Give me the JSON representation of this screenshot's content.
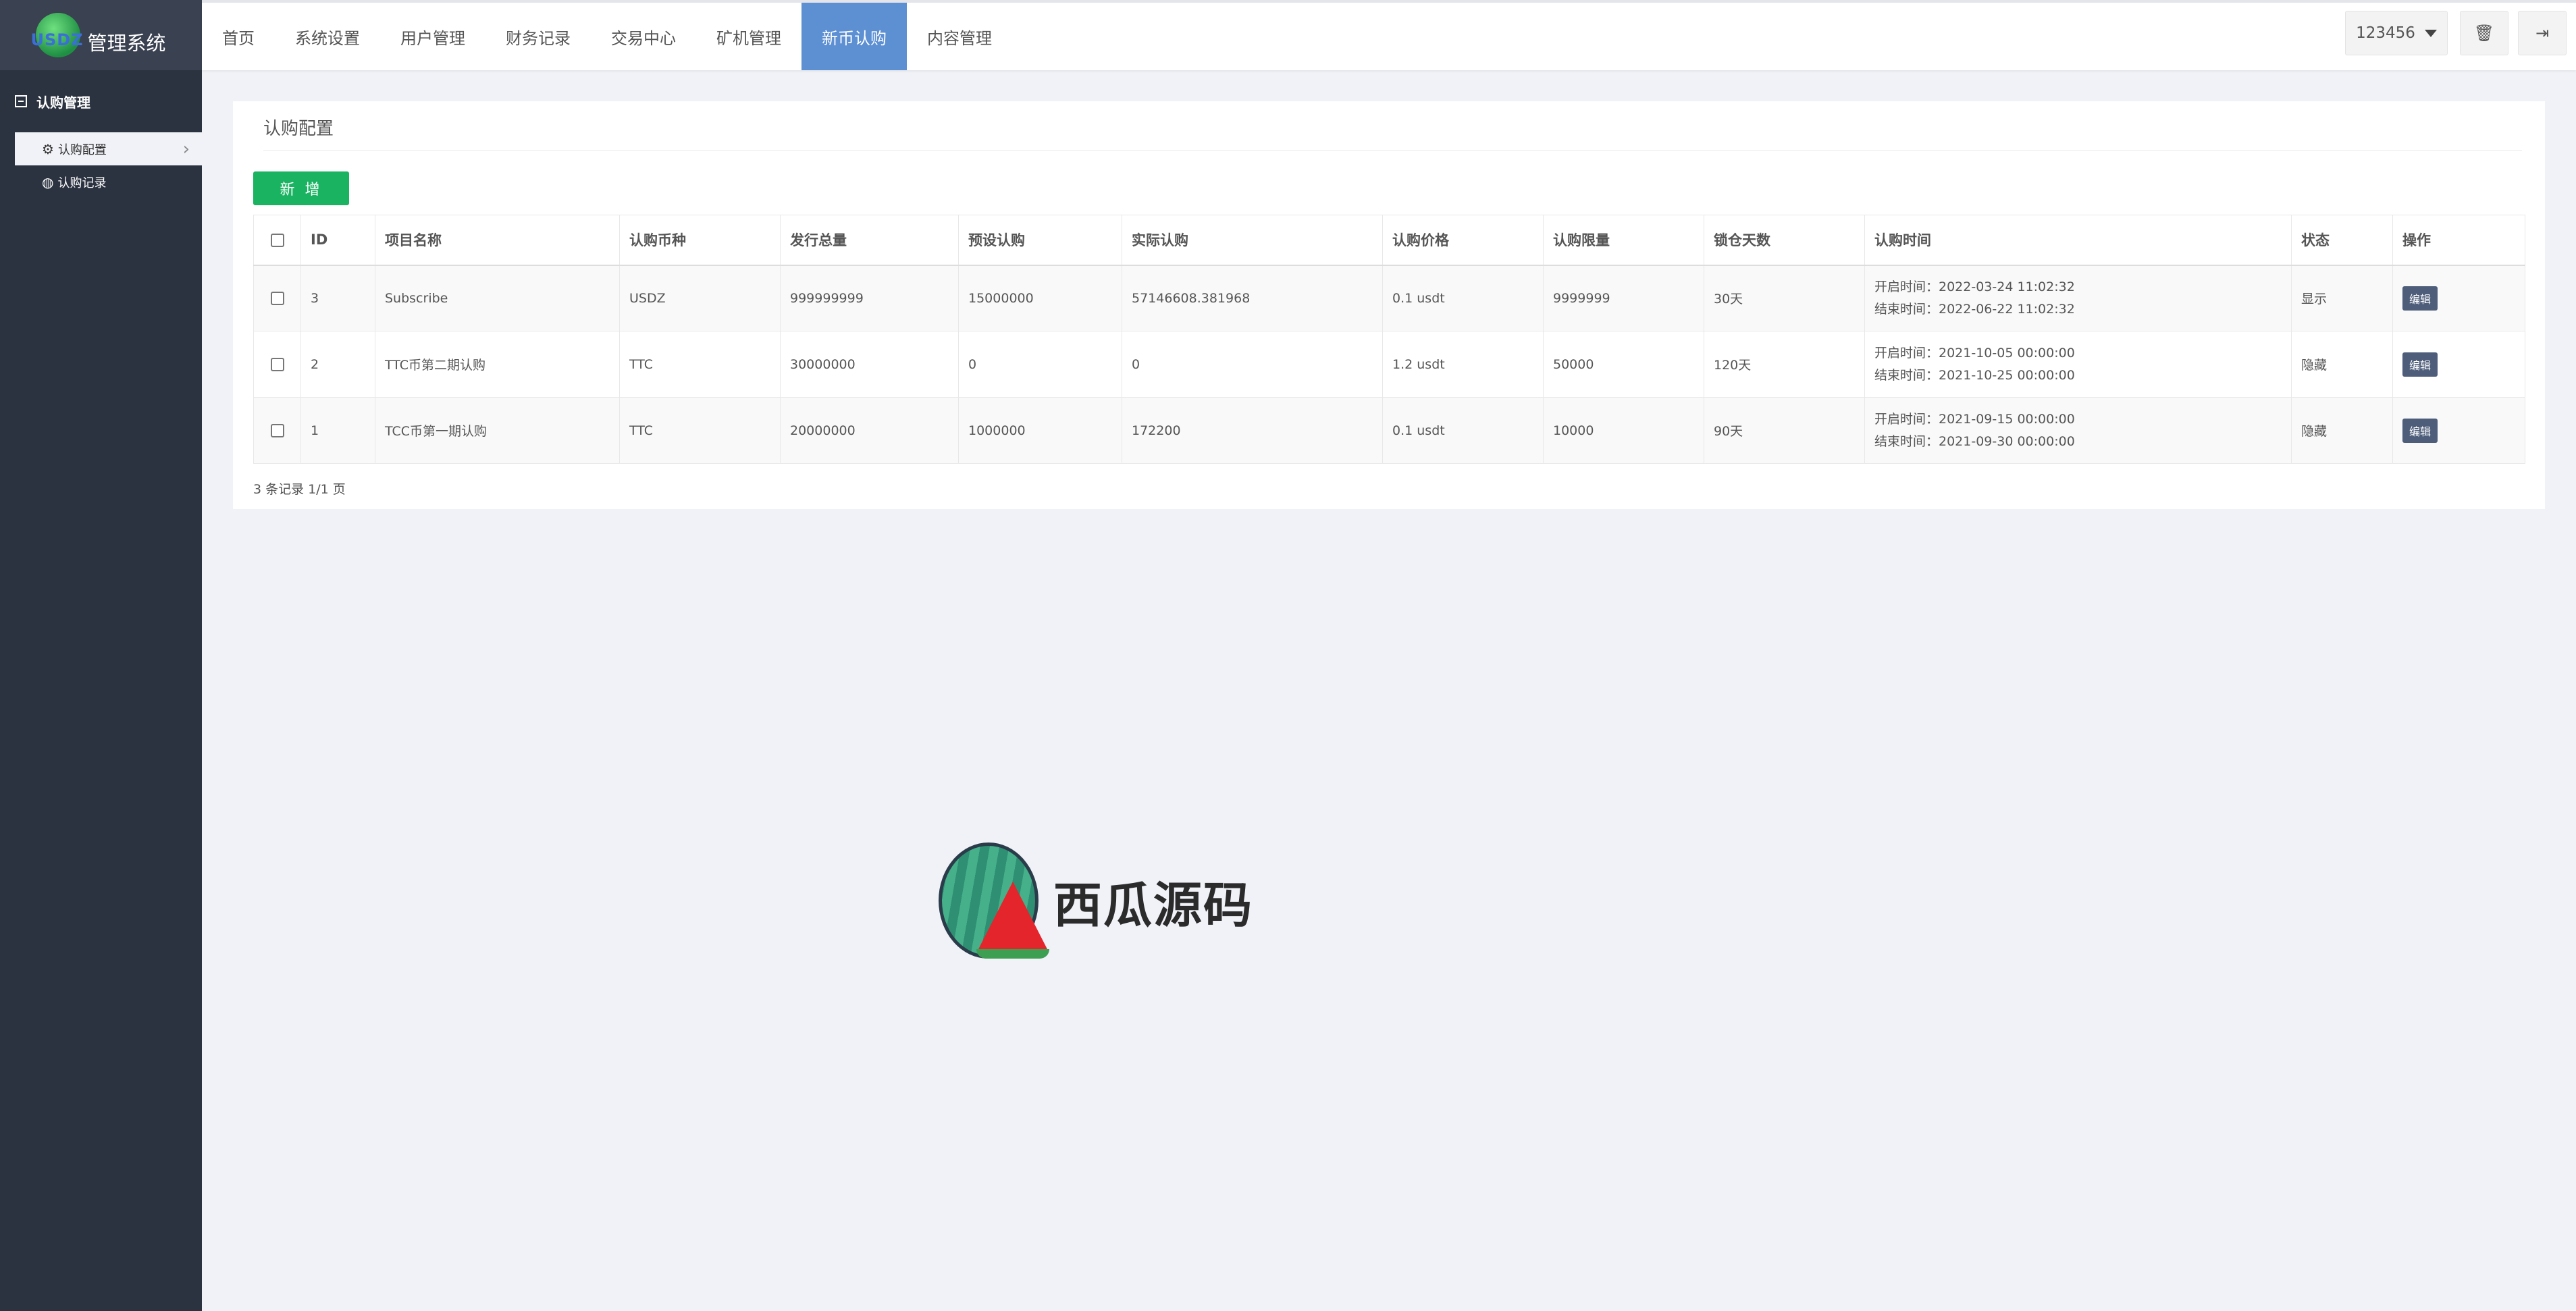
{
  "logo": {
    "mark": "USDZ",
    "text": "管理系统"
  },
  "sidebar": {
    "group_label": "认购管理",
    "items": [
      {
        "label": "认购配置",
        "icon": "gear-icon"
      },
      {
        "label": "认购记录",
        "icon": "globe-icon"
      }
    ]
  },
  "nav": {
    "items": [
      "首页",
      "系统设置",
      "用户管理",
      "财务记录",
      "交易中心",
      "矿机管理",
      "新币认购",
      "内容管理"
    ],
    "active_index": 6
  },
  "header": {
    "user": "123456",
    "clear_cache_icon": "trash-icon",
    "logout_icon": "logout-icon"
  },
  "panel": {
    "title": "认购配置",
    "add_label": "新 增",
    "footer": "3 条记录 1/1 页"
  },
  "table": {
    "columns": [
      "ID",
      "项目名称",
      "认购币种",
      "发行总量",
      "预设认购",
      "实际认购",
      "认购价格",
      "认购限量",
      "锁仓天数",
      "认购时间",
      "状态",
      "操作"
    ],
    "rows": [
      {
        "id": "3",
        "name": "Subscribe",
        "coin": "USDZ",
        "total": "999999999",
        "preset": "15000000",
        "actual": "57146608.381968",
        "price": "0.1 usdt",
        "limit": "9999999",
        "lock_days": "30天",
        "start": "开启时间：2022-03-24 11:02:32",
        "end": "结束时间：2022-06-22 11:02:32",
        "status": "显示",
        "action": "编辑"
      },
      {
        "id": "2",
        "name": "TTC币第二期认购",
        "coin": "TTC",
        "total": "30000000",
        "preset": "0",
        "actual": "0",
        "price": "1.2 usdt",
        "limit": "50000",
        "lock_days": "120天",
        "start": "开启时间：2021-10-05 00:00:00",
        "end": "结束时间：2021-10-25 00:00:00",
        "status": "隐藏",
        "action": "编辑"
      },
      {
        "id": "1",
        "name": "TCC币第一期认购",
        "coin": "TTC",
        "total": "20000000",
        "preset": "1000000",
        "actual": "172200",
        "price": "0.1 usdt",
        "limit": "10000",
        "lock_days": "90天",
        "start": "开启时间：2021-09-15 00:00:00",
        "end": "结束时间：2021-09-30 00:00:00",
        "status": "隐藏",
        "action": "编辑"
      }
    ]
  },
  "watermark": {
    "text": "西瓜源码"
  },
  "colors": {
    "sidebar": "#2c3340",
    "nav_active": "#5d8fd3",
    "add_button": "#1ab362",
    "edit_button": "#4d5d7a"
  }
}
